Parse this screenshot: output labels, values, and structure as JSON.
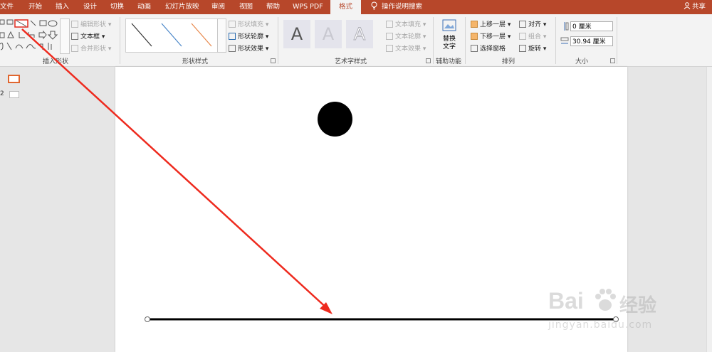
{
  "tabs": {
    "file": "文件",
    "home": "开始",
    "insert": "插入",
    "design": "设计",
    "transitions": "切换",
    "animations": "动画",
    "slideshow": "幻灯片放映",
    "review": "审阅",
    "view": "视图",
    "help": "帮助",
    "wps_pdf": "WPS PDF",
    "format": "格式",
    "tell_me": "操作说明搜索",
    "share": "共享"
  },
  "ribbon": {
    "insert_shapes": {
      "edit_shape": "编辑形状",
      "text_box": "文本框",
      "merge_shapes": "合并形状",
      "label": "插入形状"
    },
    "shape_styles": {
      "fill": "形状填充",
      "outline": "形状轮廓",
      "effects": "形状效果",
      "label": "形状样式"
    },
    "wordart": {
      "fill": "文本填充",
      "outline": "文本轮廓",
      "effects": "文本效果",
      "label": "艺术字样式",
      "sample": "A"
    },
    "accessibility": {
      "alt_text_line1": "替换",
      "alt_text_line2": "文字",
      "label": "辅助功能"
    },
    "arrange": {
      "bring_forward": "上移一层",
      "send_backward": "下移一层",
      "selection_pane": "选择窗格",
      "align": "对齐",
      "group": "组合",
      "rotate": "旋转",
      "label": "排列"
    },
    "size": {
      "height": "0 厘米",
      "width": "30.94 厘米",
      "label": "大小"
    }
  },
  "slides_pane": {
    "slide2_number": "2"
  },
  "watermark": {
    "brand": "Bai",
    "brand_cn": "经验",
    "url": "jingyan.baidu.com"
  },
  "colors": {
    "accent": "#b7472a",
    "annotation": "#ee2a1e"
  }
}
